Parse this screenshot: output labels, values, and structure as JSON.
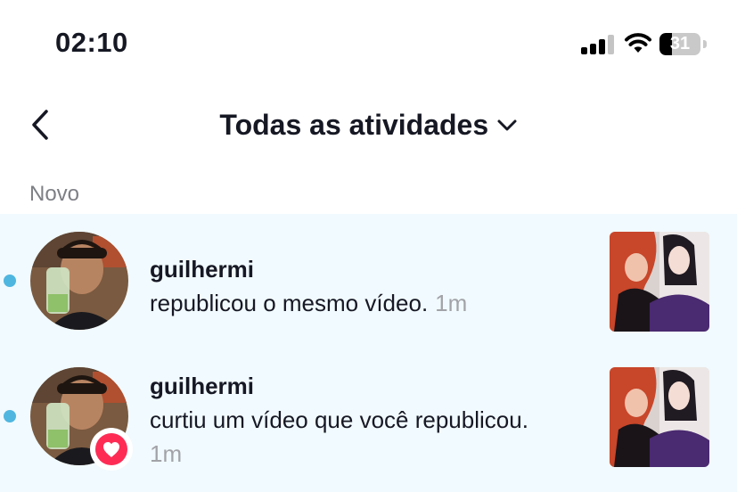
{
  "status_bar": {
    "time": "02:10",
    "battery_level": "31",
    "icons": [
      "signal-icon",
      "wifi-icon",
      "battery-icon"
    ]
  },
  "header": {
    "title": "Todas as atividades",
    "back_icon": "chevron-left-icon",
    "dropdown_icon": "chevron-down-icon"
  },
  "section": {
    "label": "Novo"
  },
  "notifications": [
    {
      "username": "guilhermi",
      "action": "republicou o mesmo vídeo.",
      "time": "1m",
      "unread": true,
      "badge": null
    },
    {
      "username": "guilhermi",
      "action": "curtiu um vídeo que você republicou.",
      "time": "1m",
      "unread": true,
      "badge": "heart-icon"
    }
  ],
  "colors": {
    "unread_dot": "#4fb6e0",
    "row_background": "#f1fafe",
    "heart": "#fe2c55",
    "muted_text": "#a1a3a8"
  }
}
